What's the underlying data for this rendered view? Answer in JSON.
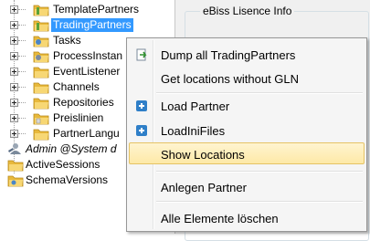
{
  "tree": {
    "items": [
      {
        "label": "TemplatePartners",
        "icon": "folder-icon"
      },
      {
        "label": "TradingPartners",
        "icon": "folder-icon",
        "selected": true
      },
      {
        "label": "Tasks",
        "icon": "folder-icon"
      },
      {
        "label": "ProcessInstan",
        "icon": "folder-icon"
      },
      {
        "label": "EventListener",
        "icon": "folder-icon"
      },
      {
        "label": "Channels",
        "icon": "folder-icon"
      },
      {
        "label": "Repositories",
        "icon": "folder-icon"
      },
      {
        "label": "Preislinien",
        "icon": "folder-icon"
      },
      {
        "label": "PartnerLangu",
        "icon": "folder-icon"
      }
    ],
    "admin_label": "Admin @System d",
    "active_sessions_label": "ActiveSessions",
    "schema_versions_label": "SchemaVersions"
  },
  "panel": {
    "groupbox_title": "eBiss Lisence Info"
  },
  "context_menu": {
    "items": [
      {
        "label": "Dump all TradingPartners",
        "icon": "export-icon"
      },
      {
        "label": "Get locations without GLN",
        "icon": ""
      },
      {
        "label": "Load Partner",
        "icon": "load-icon"
      },
      {
        "label": "LoadIniFiles",
        "icon": "load-icon"
      },
      {
        "label": "Show Locations",
        "icon": "",
        "hover": true
      },
      {
        "label": "Anlegen Partner",
        "icon": ""
      },
      {
        "label": "Alle Elemente löschen",
        "icon": ""
      }
    ]
  },
  "colors": {
    "selection": "#3399ff",
    "folder": "#f0c850",
    "menu_hover": "#fde9a7"
  }
}
